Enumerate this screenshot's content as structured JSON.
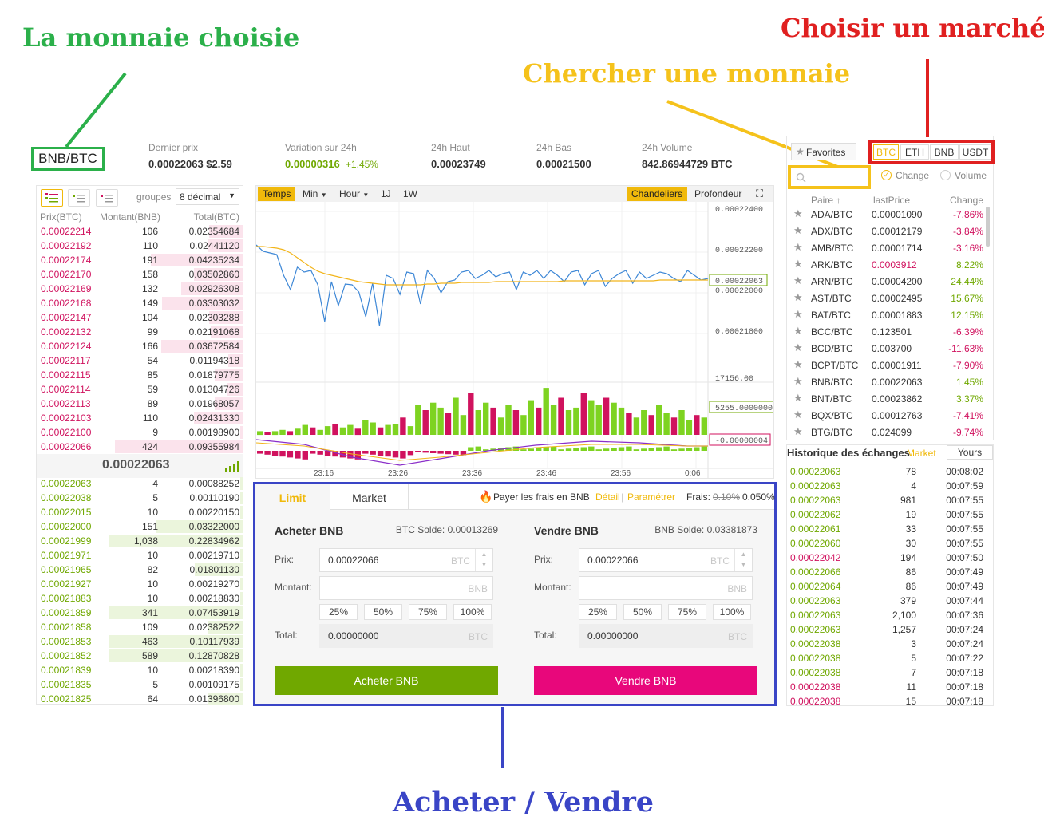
{
  "annotations": {
    "selected_coin": "La monnaie choisie",
    "choose_market": "Choisir un marché",
    "search_coin": "Chercher une monnaie",
    "buy_sell": "Acheter / Vendre",
    "colors": {
      "green": "#2bb04a",
      "red": "#e02020",
      "yellow": "#f5c21b",
      "blue": "#3a45c6"
    }
  },
  "ticker": {
    "pair": "BNB/BTC",
    "last_price_label": "Dernier prix",
    "last_price": "0.00022063 $2.59",
    "change_label": "Variation sur 24h",
    "change_value": "0.00000316",
    "change_pct": "+1.45%",
    "high_label": "24h Haut",
    "high": "0.00023749",
    "low_label": "24h Bas",
    "low": "0.00021500",
    "volume_label": "24h Volume",
    "volume": "842.86944729 BTC"
  },
  "orderbook": {
    "groups_label": "groupes",
    "decimals": "8 décimal",
    "headers": [
      "Prix(BTC)",
      "Montant(BNB)",
      "Total(BTC)"
    ],
    "last_price": "0.00022063",
    "asks": [
      {
        "price": "0.00022214",
        "amount": "106",
        "total": "0.02354684",
        "depth": 0.26
      },
      {
        "price": "0.00022192",
        "amount": "110",
        "total": "0.02441120",
        "depth": 0.27
      },
      {
        "price": "0.00022174",
        "amount": "191",
        "total": "0.04235234",
        "depth": 0.72
      },
      {
        "price": "0.00022170",
        "amount": "158",
        "total": "0.03502860",
        "depth": 0.38
      },
      {
        "price": "0.00022169",
        "amount": "132",
        "total": "0.02926308",
        "depth": 0.48
      },
      {
        "price": "0.00022168",
        "amount": "149",
        "total": "0.03303032",
        "depth": 0.63
      },
      {
        "price": "0.00022147",
        "amount": "104",
        "total": "0.02303288",
        "depth": 0.26
      },
      {
        "price": "0.00022132",
        "amount": "99",
        "total": "0.02191068",
        "depth": 0.25
      },
      {
        "price": "0.00022124",
        "amount": "166",
        "total": "0.03672584",
        "depth": 0.64
      },
      {
        "price": "0.00022117",
        "amount": "54",
        "total": "0.01194318",
        "depth": 0.11
      },
      {
        "price": "0.00022115",
        "amount": "85",
        "total": "0.01879775",
        "depth": 0.22
      },
      {
        "price": "0.00022114",
        "amount": "59",
        "total": "0.01304726",
        "depth": 0.12
      },
      {
        "price": "0.00022113",
        "amount": "89",
        "total": "0.01968057",
        "depth": 0.22
      },
      {
        "price": "0.00022103",
        "amount": "110",
        "total": "0.02431330",
        "depth": 0.38
      },
      {
        "price": "0.00022100",
        "amount": "9",
        "total": "0.00198900",
        "depth": 0.02
      },
      {
        "price": "0.00022066",
        "amount": "424",
        "total": "0.09355984",
        "depth": 1.0
      }
    ],
    "bids": [
      {
        "price": "0.00022063",
        "amount": "4",
        "total": "0.00088252",
        "depth": 0.02
      },
      {
        "price": "0.00022038",
        "amount": "5",
        "total": "0.00110190",
        "depth": 0.02
      },
      {
        "price": "0.00022015",
        "amount": "10",
        "total": "0.00220150",
        "depth": 0.02
      },
      {
        "price": "0.00022000",
        "amount": "151",
        "total": "0.03322000",
        "depth": 0.64
      },
      {
        "price": "0.00021999",
        "amount": "1,038",
        "total": "0.22834962",
        "depth": 1.0
      },
      {
        "price": "0.00021971",
        "amount": "10",
        "total": "0.00219710",
        "depth": 0.02
      },
      {
        "price": "0.00021965",
        "amount": "82",
        "total": "0.01801130",
        "depth": 0.36
      },
      {
        "price": "0.00021927",
        "amount": "10",
        "total": "0.00219270",
        "depth": 0.02
      },
      {
        "price": "0.00021883",
        "amount": "10",
        "total": "0.00218830",
        "depth": 0.02
      },
      {
        "price": "0.00021859",
        "amount": "341",
        "total": "0.07453919",
        "depth": 1.0
      },
      {
        "price": "0.00021858",
        "amount": "109",
        "total": "0.02382522",
        "depth": 0.26
      },
      {
        "price": "0.00021853",
        "amount": "463",
        "total": "0.10117939",
        "depth": 1.0
      },
      {
        "price": "0.00021852",
        "amount": "589",
        "total": "0.12870828",
        "depth": 1.0
      },
      {
        "price": "0.00021839",
        "amount": "10",
        "total": "0.00218390",
        "depth": 0.02
      },
      {
        "price": "0.00021835",
        "amount": "5",
        "total": "0.00109175",
        "depth": 0.02
      },
      {
        "price": "0.00021825",
        "amount": "64",
        "total": "0.01396800",
        "depth": 0.26
      }
    ]
  },
  "chart": {
    "toolbar": {
      "time": "Temps",
      "min": "Min",
      "hour": "Hour",
      "d1": "1J",
      "w1": "1W",
      "candles": "Chandeliers",
      "depth": "Profondeur"
    },
    "price_axis": [
      "0.00022400",
      "0.00022200",
      "0.00022000",
      "0.00021800"
    ],
    "current_price_tag": "0.00022063",
    "volume_axis": "17156.00",
    "volume_tag": "5255.0000000",
    "macd_tag": "-0.00000004",
    "time_axis": [
      "23:16",
      "23:26",
      "23:36",
      "23:46",
      "23:56",
      "0:06"
    ],
    "colors": {
      "price": "#3d87d6",
      "ma": "#f2b51b",
      "up": "#7ed321",
      "down": "#d0125e",
      "macd": "#8b2fc9"
    }
  },
  "trade": {
    "tabs": [
      "Limit",
      "Market"
    ],
    "fee_bnb": "Payer les frais en BNB",
    "detail": "Détail",
    "separator": "|",
    "settings": "Paramétrer",
    "fees_label": "Frais:",
    "fee_old": "0.10%",
    "fee_new": "0.050%",
    "buy": {
      "title": "Acheter BNB",
      "balance": "BTC Solde: 0.00013269",
      "price_label": "Prix:",
      "price": "0.00022066",
      "price_unit": "BTC",
      "amount_label": "Montant:",
      "amount_unit": "BNB",
      "total_label": "Total:",
      "total": "0.00000000",
      "total_unit": "BTC",
      "button": "Acheter BNB",
      "color": "#70a800"
    },
    "sell": {
      "title": "Vendre BNB",
      "balance": "BNB Solde: 0.03381873",
      "price_label": "Prix:",
      "price": "0.00022066",
      "price_unit": "BTC",
      "amount_label": "Montant:",
      "amount_unit": "BNB",
      "total_label": "Total:",
      "total": "0.00000000",
      "total_unit": "BTC",
      "button": "Vendre BNB",
      "color": "#e8077b"
    },
    "percents": [
      "25%",
      "50%",
      "75%",
      "100%"
    ]
  },
  "markets": {
    "favorites": "Favorites",
    "tabs": [
      "BTC",
      "ETH",
      "BNB",
      "USDT"
    ],
    "active_tab": "BTC",
    "radio_change": "Change",
    "radio_volume": "Volume",
    "headers": [
      "Paire",
      "lastPrice",
      "Change"
    ],
    "rows": [
      {
        "pair": "ADA/BTC",
        "price": "0.00001090",
        "change": "-7.86%",
        "up": false
      },
      {
        "pair": "ADX/BTC",
        "price": "0.00012179",
        "change": "-3.84%",
        "up": false
      },
      {
        "pair": "AMB/BTC",
        "price": "0.00001714",
        "change": "-3.16%",
        "up": false
      },
      {
        "pair": "ARK/BTC",
        "price": "0.0003912",
        "change": "8.22%",
        "up": true,
        "price_red": true
      },
      {
        "pair": "ARN/BTC",
        "price": "0.00004200",
        "change": "24.44%",
        "up": true
      },
      {
        "pair": "AST/BTC",
        "price": "0.00002495",
        "change": "15.67%",
        "up": true
      },
      {
        "pair": "BAT/BTC",
        "price": "0.00001883",
        "change": "12.15%",
        "up": true
      },
      {
        "pair": "BCC/BTC",
        "price": "0.123501",
        "change": "-6.39%",
        "up": false
      },
      {
        "pair": "BCD/BTC",
        "price": "0.003700",
        "change": "-11.63%",
        "up": false
      },
      {
        "pair": "BCPT/BTC",
        "price": "0.00001911",
        "change": "-7.90%",
        "up": false
      },
      {
        "pair": "BNB/BTC",
        "price": "0.00022063",
        "change": "1.45%",
        "up": true
      },
      {
        "pair": "BNT/BTC",
        "price": "0.00023862",
        "change": "3.37%",
        "up": true
      },
      {
        "pair": "BQX/BTC",
        "price": "0.00012763",
        "change": "-7.41%",
        "up": false
      },
      {
        "pair": "BTG/BTC",
        "price": "0.024099",
        "change": "-9.74%",
        "up": false
      }
    ]
  },
  "history": {
    "title": "Historique des échanges",
    "tab_market": "Market",
    "tab_yours": "Yours",
    "rows": [
      {
        "price": "0.00022063",
        "amount": "78",
        "time": "00:08:02",
        "up": true
      },
      {
        "price": "0.00022063",
        "amount": "4",
        "time": "00:07:59",
        "up": true
      },
      {
        "price": "0.00022063",
        "amount": "981",
        "time": "00:07:55",
        "up": true
      },
      {
        "price": "0.00022062",
        "amount": "19",
        "time": "00:07:55",
        "up": true
      },
      {
        "price": "0.00022061",
        "amount": "33",
        "time": "00:07:55",
        "up": true
      },
      {
        "price": "0.00022060",
        "amount": "30",
        "time": "00:07:55",
        "up": true
      },
      {
        "price": "0.00022042",
        "amount": "194",
        "time": "00:07:50",
        "up": false
      },
      {
        "price": "0.00022066",
        "amount": "86",
        "time": "00:07:49",
        "up": true
      },
      {
        "price": "0.00022064",
        "amount": "86",
        "time": "00:07:49",
        "up": true
      },
      {
        "price": "0.00022063",
        "amount": "379",
        "time": "00:07:44",
        "up": true
      },
      {
        "price": "0.00022063",
        "amount": "2,100",
        "time": "00:07:36",
        "up": true
      },
      {
        "price": "0.00022063",
        "amount": "1,257",
        "time": "00:07:24",
        "up": true
      },
      {
        "price": "0.00022038",
        "amount": "3",
        "time": "00:07:24",
        "up": true
      },
      {
        "price": "0.00022038",
        "amount": "5",
        "time": "00:07:22",
        "up": true
      },
      {
        "price": "0.00022038",
        "amount": "7",
        "time": "00:07:18",
        "up": true
      },
      {
        "price": "0.00022038",
        "amount": "11",
        "time": "00:07:18",
        "up": false
      },
      {
        "price": "0.00022038",
        "amount": "15",
        "time": "00:07:18",
        "up": false
      }
    ]
  }
}
